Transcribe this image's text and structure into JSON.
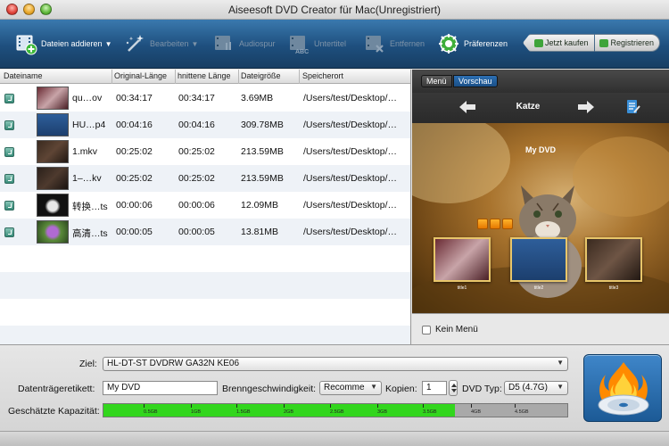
{
  "window": {
    "title": "Aiseesoft DVD Creator für Mac(Unregistriert)"
  },
  "toolbar": {
    "add_label": "Dateien addieren",
    "edit_label": "Bearbeiten",
    "audio_label": "Audiospur",
    "subtitle_label": "Untertitel",
    "remove_label": "Entfernen",
    "prefs_label": "Präferenzen",
    "buy_label": "Jetzt kaufen",
    "register_label": "Registrieren"
  },
  "table": {
    "headers": [
      "Dateiname",
      "Original-Länge",
      "hnittene Länge",
      "Dateigröße",
      "Speicherort"
    ],
    "rows": [
      {
        "name": "qu…ov",
        "orig": "00:34:17",
        "cut": "00:34:17",
        "size": "3.69MB",
        "path": "/Users/test/Desktop/…"
      },
      {
        "name": "HU…p4",
        "orig": "00:04:16",
        "cut": "00:04:16",
        "size": "309.78MB",
        "path": "/Users/test/Desktop/…"
      },
      {
        "name": "1.mkv",
        "orig": "00:25:02",
        "cut": "00:25:02",
        "size": "213.59MB",
        "path": "/Users/test/Desktop/…"
      },
      {
        "name": "1–…kv",
        "orig": "00:25:02",
        "cut": "00:25:02",
        "size": "213.59MB",
        "path": "/Users/test/Desktop/…"
      },
      {
        "name": "转换…ts",
        "orig": "00:00:06",
        "cut": "00:00:06",
        "size": "12.09MB",
        "path": "/Users/test/Desktop/…"
      },
      {
        "name": "高清…ts",
        "orig": "00:00:05",
        "cut": "00:00:05",
        "size": "13.81MB",
        "path": "/Users/test/Desktop/…"
      }
    ]
  },
  "preview": {
    "tab_menu": "Menü",
    "tab_preview": "Vorschau",
    "nav_title": "Katze",
    "menu_title": "My DVD",
    "tile_captions": [
      "title1",
      "title2",
      "title3"
    ],
    "kein_menu_label": "Kein Menü"
  },
  "bottom": {
    "ziel_label": "Ziel:",
    "ziel_value": "HL-DT-ST DVDRW  GA32N KE06",
    "volume_label": "Datenträgeretikett:",
    "volume_value": "My DVD",
    "speed_label": "Brenngeschwindigkeit:",
    "speed_value": "Recomme",
    "copies_label": "Kopien:",
    "copies_value": "1",
    "dvdtype_label": "DVD Typ:",
    "dvdtype_value": "D5 (4.7G)",
    "capacity_label": "Geschätzte Kapazität:",
    "capacity_fraction": 0.757,
    "capacity_ticks": [
      "0.5GB",
      "1GB",
      "1.5GB",
      "2GB",
      "2.5GB",
      "3GB",
      "3.5GB",
      "4GB",
      "4.5GB"
    ]
  },
  "colors": {
    "toolbar_blue": "#1e4f7e",
    "capacity_fill": "#32d61d",
    "burn_button": "#2a6fb0"
  },
  "icons": {
    "add": "film-add-icon",
    "edit": "magic-wand-icon",
    "audio": "film-audio-icon",
    "subtitle": "film-abc-icon",
    "remove": "film-remove-icon",
    "prefs": "gear-icon",
    "buy": "cart-icon",
    "register": "key-icon",
    "burn": "burning-disc-icon"
  }
}
